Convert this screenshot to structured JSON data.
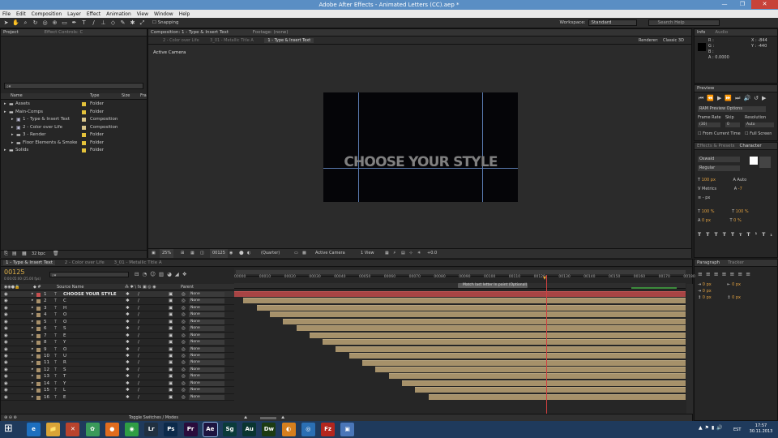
{
  "window": {
    "title": "Adobe After Effects - Animated Letters (CC).aep *",
    "minimize": "—",
    "maximize": "❐",
    "close": "✕"
  },
  "menu": [
    "File",
    "Edit",
    "Composition",
    "Layer",
    "Effect",
    "Animation",
    "View",
    "Window",
    "Help"
  ],
  "toolbar": {
    "snapping": "Snapping",
    "workspace_label": "Workspace:",
    "workspace_value": "Standard",
    "search_placeholder": "Search Help"
  },
  "project_panel": {
    "tab": "Project",
    "effect_controls": "Effect Controls: C",
    "columns": [
      "Name",
      "Type",
      "Size",
      "Fra"
    ],
    "items": [
      {
        "name": "Assets",
        "type": "Folder",
        "indent": 0,
        "color": "#e4c23a",
        "folder": true
      },
      {
        "name": "Main-Comps",
        "type": "Folder",
        "indent": 0,
        "color": "#e4c23a",
        "folder": true
      },
      {
        "name": "1 - Type & Insert Text",
        "type": "Composition",
        "indent": 1,
        "color": "#d9c58a",
        "folder": false
      },
      {
        "name": "2 - Color over Life",
        "type": "Composition",
        "indent": 1,
        "color": "#d9c58a",
        "folder": false
      },
      {
        "name": "3 - Render",
        "type": "Folder",
        "indent": 1,
        "color": "#e4c23a",
        "folder": true
      },
      {
        "name": "Floor Elements & Smoke",
        "type": "Folder",
        "indent": 1,
        "color": "#e4c23a",
        "folder": true
      },
      {
        "name": "Solids",
        "type": "Folder",
        "indent": 0,
        "color": "#e4c23a",
        "folder": true
      }
    ],
    "bpc": "32 bpc"
  },
  "comp_panel": {
    "tab": "Composition: 1 - Type & Insert Text",
    "footage_tab": "Footage: (none)",
    "subtabs": [
      "2 - Color over Life",
      "3_01 - Metallic Title A",
      "1 - Type & Insert Text"
    ],
    "renderer_label": "Renderer:",
    "renderer": "Classic 3D",
    "active_camera": "Active Camera",
    "canvas_text": "CHOOSE YOUR STYLE",
    "zoom": "25%",
    "timecode": "00125",
    "resolution": "(Quarter)",
    "view": "Active Camera",
    "views": "1 View",
    "exposure": "+0.0"
  },
  "info_panel": {
    "tab1": "Info",
    "tab2": "Audio",
    "r": "R :",
    "g": "G :",
    "b": "B :",
    "a": "A : 0.0000",
    "x": "X : -844",
    "y": "Y : -440"
  },
  "preview_panel": {
    "tab": "Preview",
    "ram": "RAM Preview Options",
    "frame_rate": "Frame Rate",
    "skip": "Skip",
    "resolution": "Resolution",
    "frame_rate_val": "(30)",
    "skip_val": "0",
    "res_val": "Auto",
    "from_current": "From Current Time",
    "full_screen": "Full Screen"
  },
  "character_panel": {
    "tab1": "Effects & Presets",
    "tab2": "Character",
    "font": "Oswald",
    "style": "Regular",
    "size": "100 px",
    "leading": "Auto",
    "kerning": "Metrics",
    "tracking": "-7",
    "stroke": "- px",
    "vscale": "100 %",
    "hscale": "100 %",
    "baseline": "0 px",
    "tsume": "0 %"
  },
  "paragraph_panel": {
    "tab1": "Paragraph",
    "tab2": "Tracker",
    "v1": "0 px",
    "v2": "0 px",
    "v3": "0 px",
    "v4": "0 px",
    "v5": "0 px"
  },
  "timeline": {
    "tabs": [
      "1 - Type & Insert Text",
      "2 - Color over Life",
      "3_01 - Metallic Title A"
    ],
    "timecode": "00125",
    "timecode_sub": "0:00:05:00 (25.00 fps)",
    "col_source": "Source Name",
    "col_parent": "Parent",
    "marker": "Match last letter In point (Optional)",
    "ruler": [
      "00000",
      "00010",
      "00020",
      "00030",
      "00040",
      "00050",
      "00060",
      "00070",
      "00080",
      "00090",
      "00100",
      "00110",
      "00120",
      "00130",
      "00140",
      "00150",
      "00160",
      "00170",
      "00180"
    ],
    "toggle": "Toggle Switches / Modes",
    "layers": [
      {
        "n": "1",
        "name": "CHOOSE YOUR STYLE",
        "color": "#c85050"
      },
      {
        "n": "2",
        "name": "C",
        "color": "#a8906a"
      },
      {
        "n": "3",
        "name": "H",
        "color": "#a8906a"
      },
      {
        "n": "4",
        "name": "O",
        "color": "#a8906a"
      },
      {
        "n": "5",
        "name": "O",
        "color": "#a8906a"
      },
      {
        "n": "6",
        "name": "S",
        "color": "#a8906a"
      },
      {
        "n": "7",
        "name": "E",
        "color": "#a8906a"
      },
      {
        "n": "8",
        "name": "Y",
        "color": "#a8906a"
      },
      {
        "n": "9",
        "name": "O",
        "color": "#a8906a"
      },
      {
        "n": "10",
        "name": "U",
        "color": "#a8906a"
      },
      {
        "n": "11",
        "name": "R",
        "color": "#a8906a"
      },
      {
        "n": "12",
        "name": "S",
        "color": "#a8906a"
      },
      {
        "n": "13",
        "name": "T",
        "color": "#a8906a"
      },
      {
        "n": "14",
        "name": "Y",
        "color": "#a8906a"
      },
      {
        "n": "15",
        "name": "L",
        "color": "#a8906a"
      },
      {
        "n": "16",
        "name": "E",
        "color": "#a8906a"
      }
    ],
    "parent_none": "None"
  },
  "taskbar": {
    "time": "17:57",
    "date": "30.11.2013",
    "lang": "EST",
    "apps": [
      {
        "label": "e",
        "color": "#1d6fbf",
        "name": "internet-explorer-icon"
      },
      {
        "label": "📁",
        "color": "#d9a437",
        "name": "file-explorer-icon"
      },
      {
        "label": "✕",
        "color": "#b8432d",
        "name": "tools-icon"
      },
      {
        "label": "✿",
        "color": "#3a9a5a",
        "name": "paint-icon"
      },
      {
        "label": "●",
        "color": "#e06c1e",
        "name": "firefox-icon"
      },
      {
        "label": "◉",
        "color": "#2f9e44",
        "name": "chrome-icon"
      },
      {
        "label": "Lr",
        "color": "#203040",
        "name": "lightroom-icon"
      },
      {
        "label": "Ps",
        "color": "#0c2a4a",
        "name": "photoshop-icon"
      },
      {
        "label": "Pr",
        "color": "#2a0c3c",
        "name": "premiere-icon"
      },
      {
        "label": "Ae",
        "color": "#1d1440",
        "name": "after-effects-icon"
      },
      {
        "label": "Sg",
        "color": "#0b3b3a",
        "name": "speedgrade-icon"
      },
      {
        "label": "Au",
        "color": "#0a3530",
        "name": "audition-icon"
      },
      {
        "label": "Dw",
        "color": "#1c3b12",
        "name": "dreamweaver-icon"
      },
      {
        "label": "◐",
        "color": "#d57f1e",
        "name": "blender-icon"
      },
      {
        "label": "◎",
        "color": "#2b6fb3",
        "name": "globe-icon"
      },
      {
        "label": "Fz",
        "color": "#b3261e",
        "name": "filezilla-icon"
      },
      {
        "label": "▣",
        "color": "#4a76b8",
        "name": "app-icon"
      }
    ]
  }
}
